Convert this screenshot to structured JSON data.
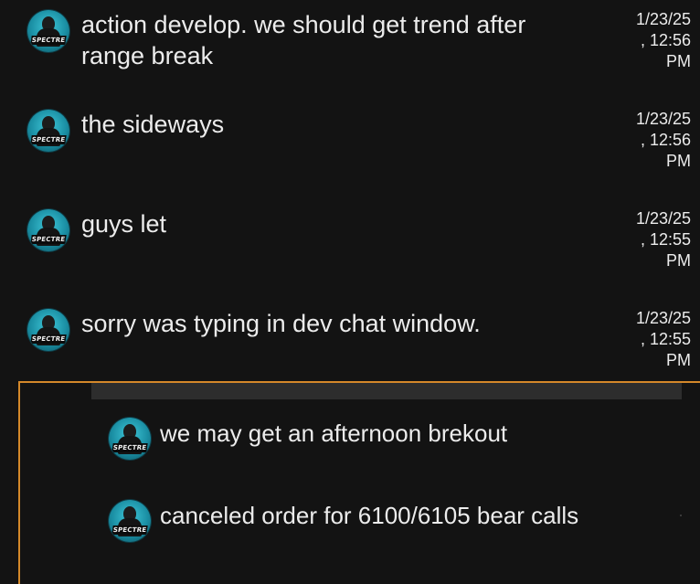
{
  "messages": [
    {
      "avatar_tag": "SPECTRE",
      "text": "action develop. we should get trend after range break",
      "time": {
        "date": "1/23/25",
        "clock": ", 12:56",
        "ampm": "PM"
      }
    },
    {
      "avatar_tag": "SPECTRE",
      "text": "the sideways",
      "time": {
        "date": "1/23/25",
        "clock": ", 12:56",
        "ampm": "PM"
      }
    },
    {
      "avatar_tag": "SPECTRE",
      "text": "guys let",
      "time": {
        "date": "1/23/25",
        "clock": ", 12:55",
        "ampm": "PM"
      }
    },
    {
      "avatar_tag": "SPECTRE",
      "text": "sorry was typing in dev chat window.",
      "time": {
        "date": "1/23/25",
        "clock": ", 12:55",
        "ampm": "PM"
      }
    }
  ],
  "thread": {
    "highlight_color": "#d4882a",
    "replies": [
      {
        "avatar_tag": "SPECTRE",
        "text": "we may get an afternoon brekout"
      },
      {
        "avatar_tag": "SPECTRE",
        "text": "canceled order for 6100/6105 bear calls"
      }
    ]
  }
}
